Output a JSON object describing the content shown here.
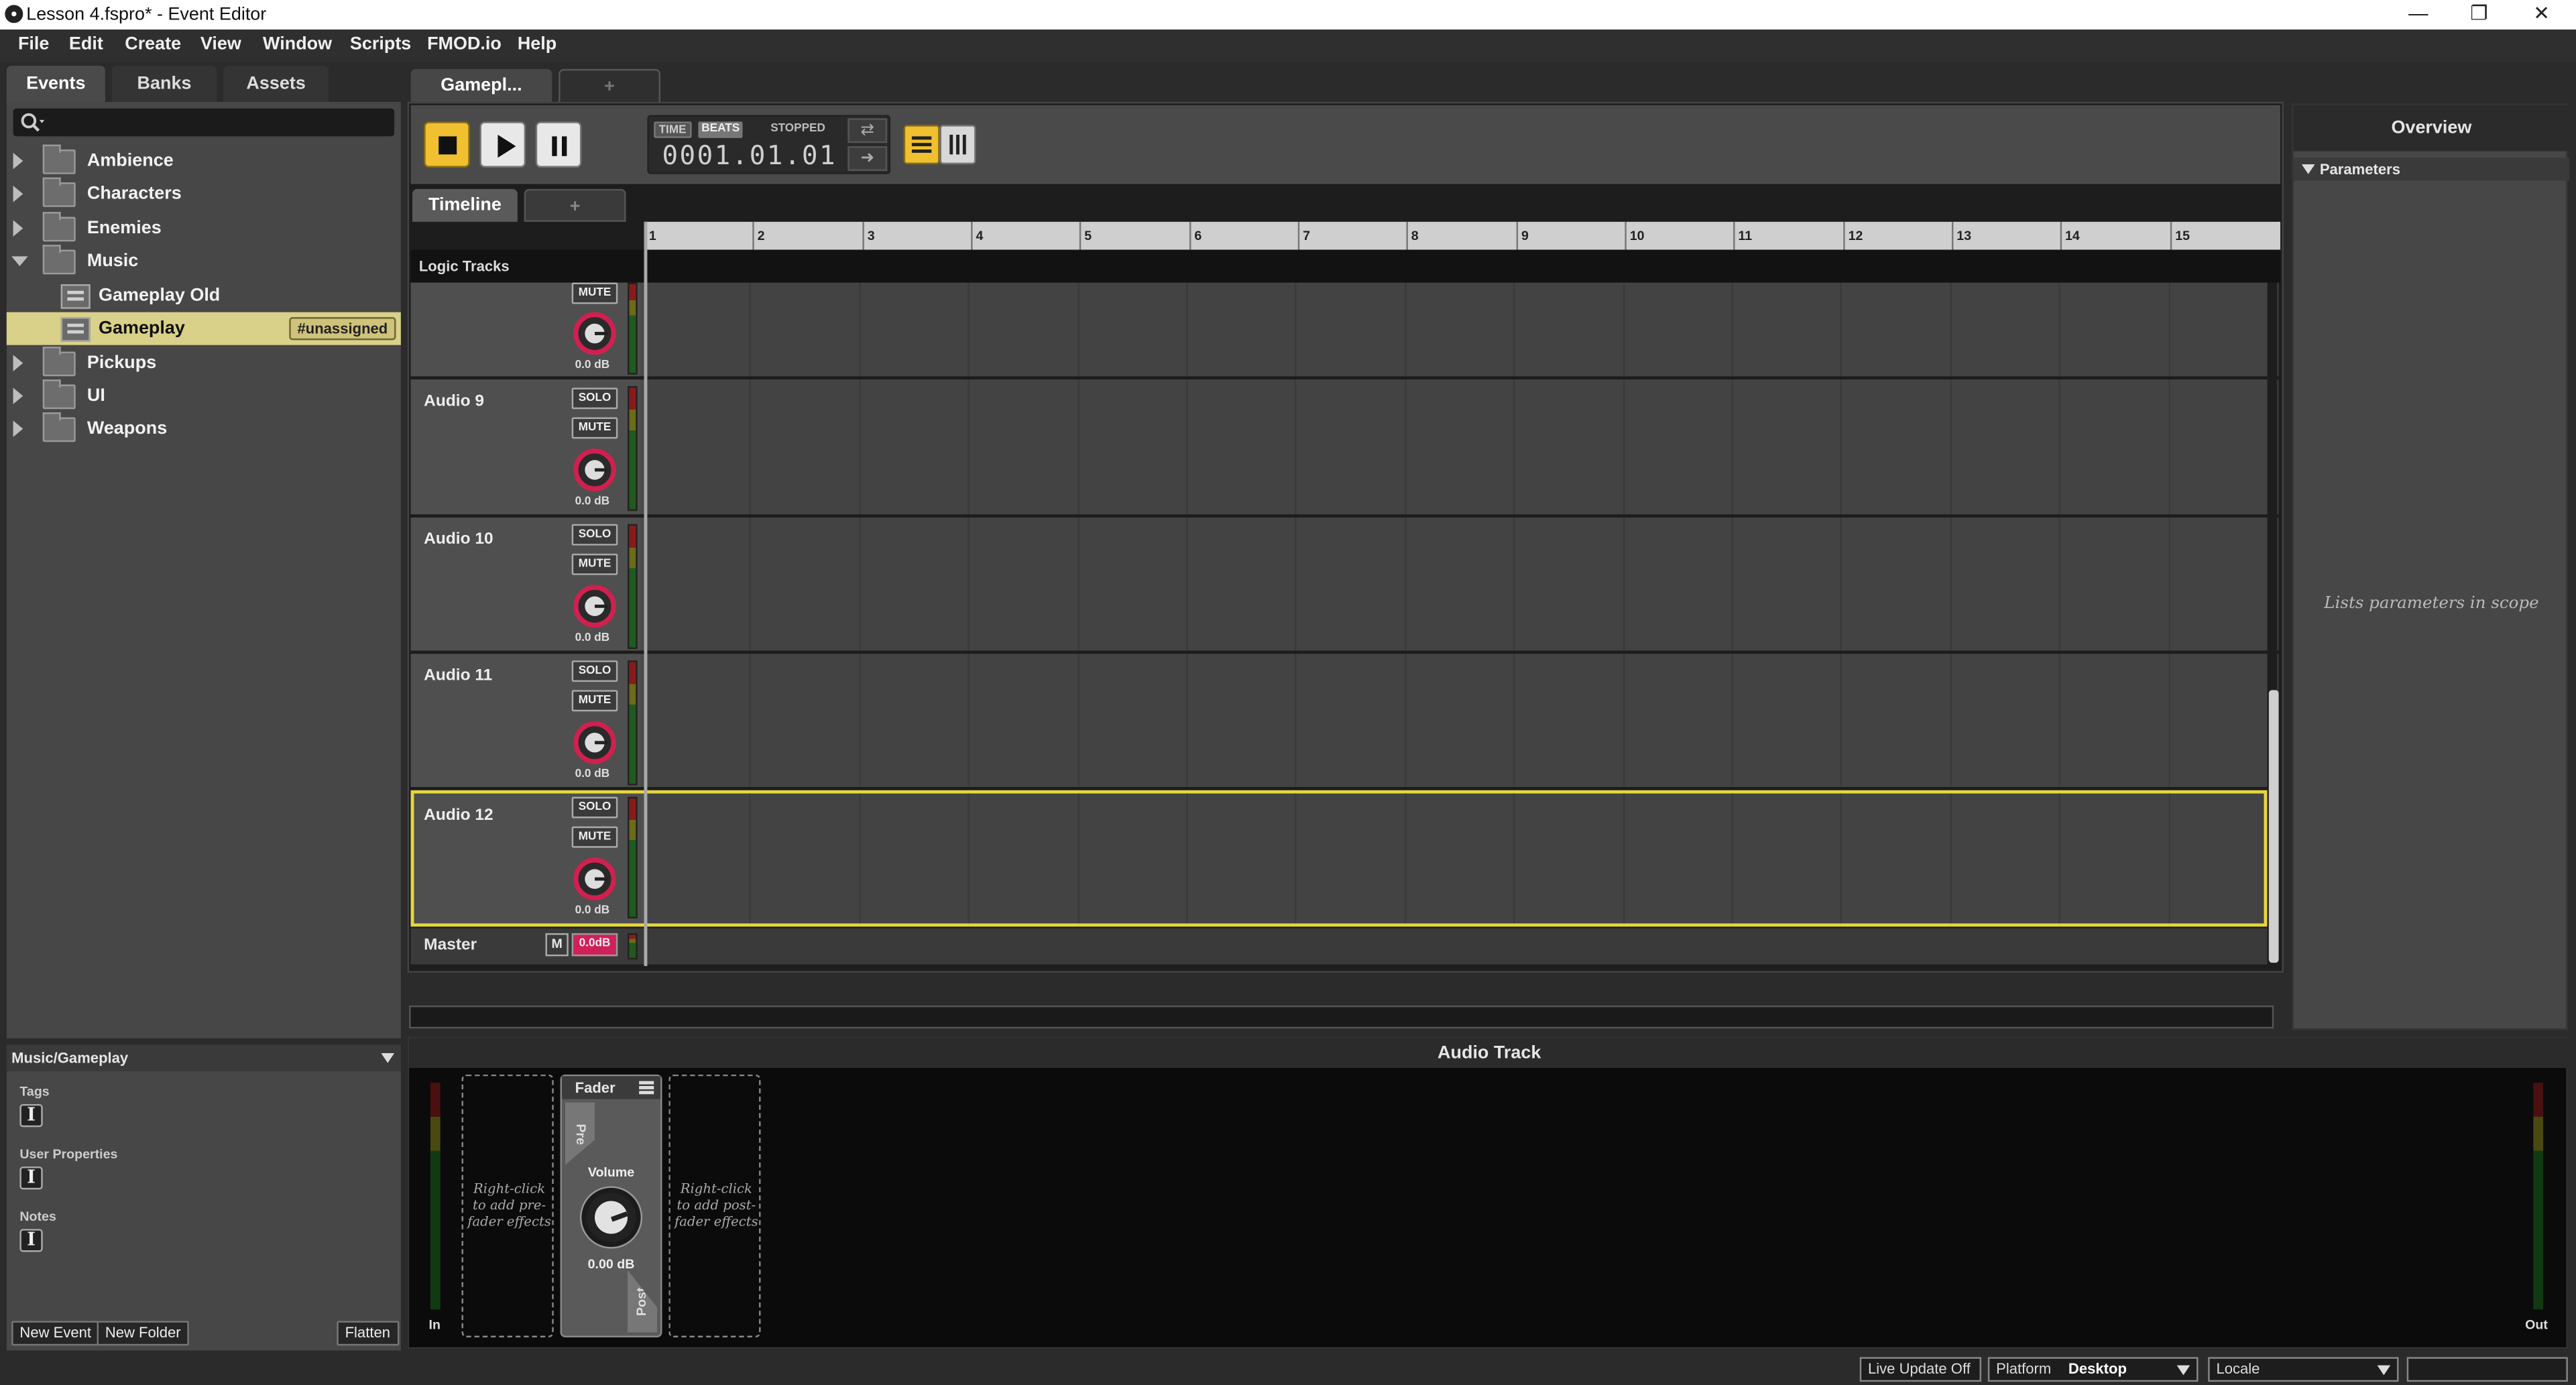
{
  "window": {
    "title": "Lesson 4.fspro* - Event Editor",
    "minimize": "—",
    "maximize": "❐",
    "close": "✕"
  },
  "menu": [
    "File",
    "Edit",
    "Create",
    "View",
    "Window",
    "Scripts",
    "FMOD.io",
    "Help"
  ],
  "browser": {
    "tabs": [
      "Events",
      "Banks",
      "Assets"
    ],
    "search_placeholder": "",
    "tree": [
      {
        "label": "Ambience"
      },
      {
        "label": "Characters"
      },
      {
        "label": "Enemies"
      },
      {
        "label": "Music"
      },
      {
        "label": "Gameplay Old"
      },
      {
        "label": "Gameplay",
        "badge": "#unassigned"
      },
      {
        "label": "Pickups"
      },
      {
        "label": "UI"
      },
      {
        "label": "Weapons"
      }
    ]
  },
  "properties": {
    "path": "Music/Gameplay",
    "tags_label": "Tags",
    "user_properties_label": "User Properties",
    "notes_label": "Notes"
  },
  "bottom_buttons": {
    "new_event": "New Event",
    "new_folder": "New Folder",
    "flatten": "Flatten"
  },
  "editor": {
    "tabs": [
      "Gamepl...",
      "+"
    ],
    "time_mode": "TIME",
    "beats_mode": "BEATS",
    "state": "STOPPED",
    "time_value": "0001.01.01",
    "sub_tabs": [
      "Timeline",
      "+"
    ],
    "ruler": [
      "1",
      "2",
      "3",
      "4",
      "5",
      "6",
      "7",
      "8",
      "9",
      "10",
      "11",
      "12",
      "13",
      "14",
      "15"
    ],
    "logic_tracks": "Logic Tracks",
    "solo": "SOLO",
    "mute": "MUTE",
    "tracks": [
      {
        "name": "",
        "db": "0.0 dB"
      },
      {
        "name": "Audio 9",
        "db": "0.0 dB"
      },
      {
        "name": "Audio 10",
        "db": "0.0 dB"
      },
      {
        "name": "Audio 11",
        "db": "0.0 dB"
      },
      {
        "name": "Audio 12",
        "db": "0.0 dB"
      }
    ],
    "master": {
      "name": "Master",
      "m": "M",
      "db": "0.0dB"
    }
  },
  "overview": {
    "title": "Overview",
    "parameters": "Parameters",
    "hint": "Lists parameters in scope"
  },
  "deck": {
    "title": "Audio Track",
    "in": "In",
    "out": "Out",
    "pre_slot": "Right-click to add pre-fader effects",
    "post_slot": "Right-click to add post-fader effects",
    "fader": "Fader",
    "pre": "Pre",
    "post": "Post",
    "volume_label": "Volume",
    "volume_value": "0.00 dB"
  },
  "status": {
    "live_update": "Live Update Off",
    "platform_label": "Platform",
    "platform_value": "Desktop",
    "locale_label": "Locale"
  },
  "colors": {
    "accent": "#f0c030",
    "selection": "#d9d08a",
    "knob_ring": "#d02050"
  }
}
